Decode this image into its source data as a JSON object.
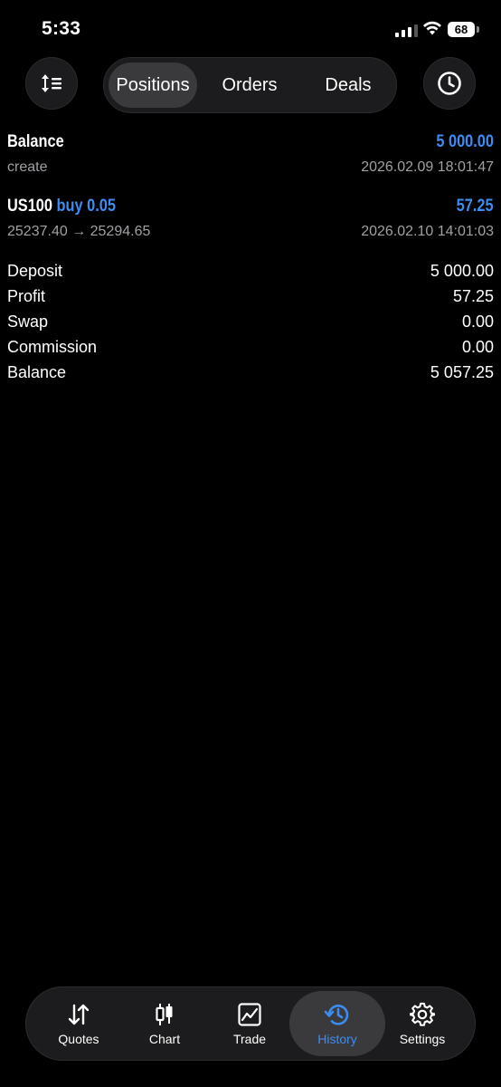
{
  "status": {
    "time": "5:33",
    "battery": "68"
  },
  "segments": {
    "positions": "Positions",
    "orders": "Orders",
    "deals": "Deals"
  },
  "entries": [
    {
      "title": "Balance",
      "title_extra": "",
      "value": "5 000.00",
      "sub_left": "create",
      "sub_right": "2026.02.09 18:01:47"
    },
    {
      "title": "US100",
      "title_extra": "buy 0.05",
      "value": "57.25",
      "sub_left": "25237.40 → 25294.65",
      "sub_right": "2026.02.10 14:01:03"
    }
  ],
  "summary": [
    {
      "label": "Deposit",
      "value": "5 000.00"
    },
    {
      "label": "Profit",
      "value": "57.25"
    },
    {
      "label": "Swap",
      "value": "0.00"
    },
    {
      "label": "Commission",
      "value": "0.00"
    },
    {
      "label": "Balance",
      "value": "5 057.25"
    }
  ],
  "tabs": {
    "quotes": "Quotes",
    "chart": "Chart",
    "trade": "Trade",
    "history": "History",
    "settings": "Settings"
  },
  "colors": {
    "accent": "#3d8cf0",
    "background": "#000000",
    "surface": "#1c1c1e"
  },
  "icons": {
    "sort": "sort-icon",
    "clock": "clock-icon",
    "quotes": "arrows-updown-icon",
    "chart": "candlestick-icon",
    "trade": "line-chart-icon",
    "history": "history-icon",
    "settings": "gear-icon"
  }
}
